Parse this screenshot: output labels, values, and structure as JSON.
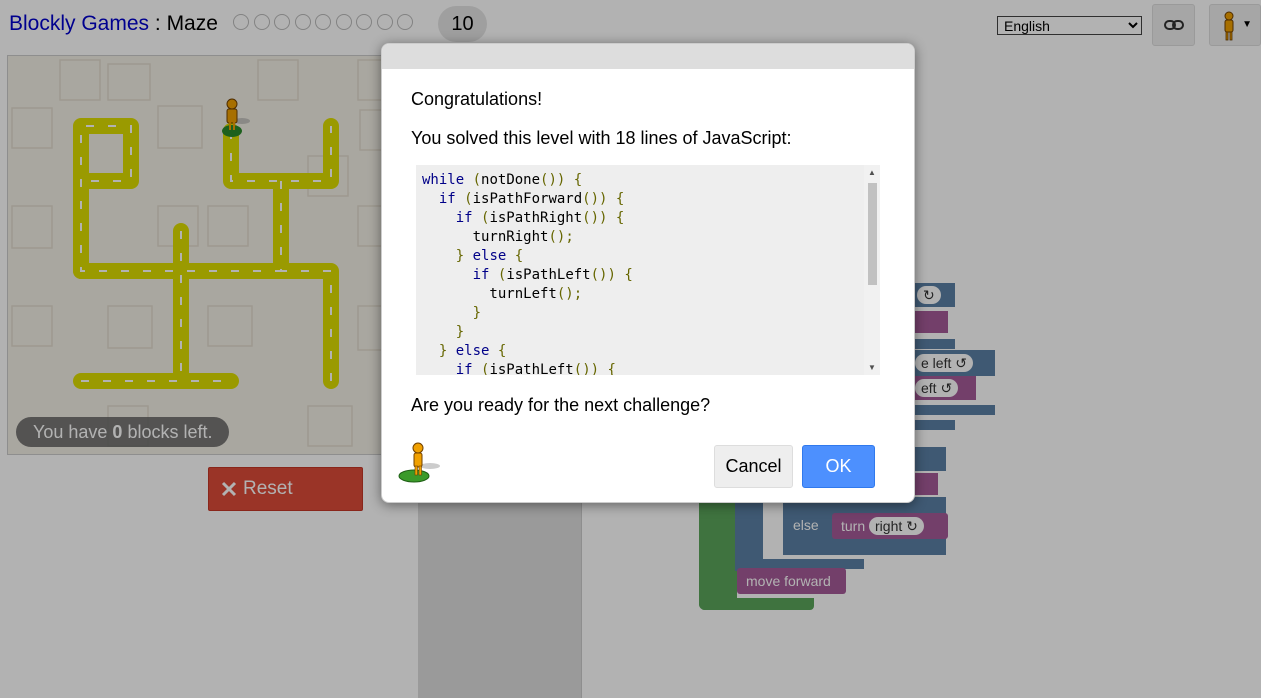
{
  "header": {
    "app_name": "Blockly Games",
    "separator": " : ",
    "game_name": "Maze",
    "level_count_done": 9,
    "current_level": "10",
    "language": "English",
    "language_options": [
      "English"
    ]
  },
  "maze": {
    "blocks_left_prefix": "You have ",
    "blocks_left_count": "0",
    "blocks_left_suffix": " blocks left.",
    "reset_label": "Reset"
  },
  "workspace_blocks": {
    "turn_left_1": "e left ↺",
    "turn_left_2": "eft ↺",
    "else_label": "else",
    "turn_label": "turn",
    "right_dropdown": "right ↻",
    "move_forward": "move forward",
    "partial_icon": "↻"
  },
  "dialog": {
    "congrats": "Congratulations!",
    "solved_prefix": "You solved this level with ",
    "lines_count": "18",
    "solved_suffix": " lines of JavaScript:",
    "code_lines": [
      "while (notDone()) {",
      "  if (isPathForward()) {",
      "    if (isPathRight()) {",
      "      turnRight();",
      "    } else {",
      "      if (isPathLeft()) {",
      "        turnLeft();",
      "      }",
      "    }",
      "  } else {",
      "    if (isPathLeft()) {"
    ],
    "next_challenge": "Are you ready for the next challenge?",
    "cancel_label": "Cancel",
    "ok_label": "OK"
  },
  "colors": {
    "path": "#dddd00",
    "logic_block": "#5b80a5",
    "action_block": "#a55b99",
    "loop_block": "#5ba55b",
    "reset_button": "#dd4b39",
    "ok_button": "#4d90fe"
  }
}
